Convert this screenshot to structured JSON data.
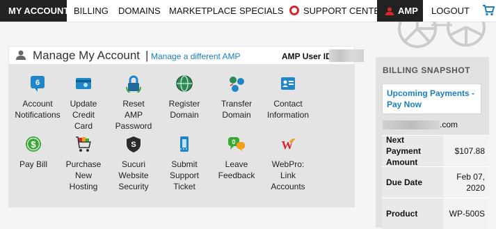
{
  "nav": {
    "my_account": "MY ACCOUNT",
    "billing": "BILLING",
    "domains": "DOMAINS",
    "marketplace": "MARKETPLACE",
    "specials": "SPECIALS",
    "support_center": "SUPPORT CENTER",
    "amp": "AMP",
    "logout": "LOGOUT"
  },
  "manage": {
    "title": "Manage My Account",
    "separator": "|",
    "link": "Manage a different AMP",
    "amp_user_id_label": "AMP User ID:",
    "tiles": [
      {
        "label1": "Account",
        "label2": "Notifications",
        "label3": "",
        "icon": "bell-badge-icon",
        "badge": "6"
      },
      {
        "label1": "Update",
        "label2": "Credit",
        "label3": "Card",
        "icon": "credit-card-icon"
      },
      {
        "label1": "Reset",
        "label2": "AMP",
        "label3": "Password",
        "icon": "lock-icon"
      },
      {
        "label1": "Register",
        "label2": "Domain",
        "label3": "",
        "icon": "globe-icon"
      },
      {
        "label1": "Transfer",
        "label2": "Domain",
        "label3": "",
        "icon": "transfer-globes-icon"
      },
      {
        "label1": "Contact",
        "label2": "Information",
        "label3": "",
        "icon": "contact-card-icon"
      },
      {
        "label1": "Pay Bill",
        "label2": "",
        "label3": "",
        "icon": "dollar-icon"
      },
      {
        "label1": "Purchase",
        "label2": "New",
        "label3": "Hosting",
        "icon": "shopping-cart-icon"
      },
      {
        "label1": "Sucuri",
        "label2": "Website",
        "label3": "Security",
        "icon": "sucuri-shield-icon"
      },
      {
        "label1": "Submit",
        "label2": "Support",
        "label3": "Ticket",
        "icon": "ticket-icon"
      },
      {
        "label1": "Leave",
        "label2": "Feedback",
        "label3": "",
        "icon": "feedback-bubbles-icon"
      },
      {
        "label1": "WebPro:",
        "label2": "Link",
        "label3": "Accounts",
        "icon": "webpro-icon"
      }
    ]
  },
  "billing": {
    "title": "BILLING SNAPSHOT",
    "upcoming": "Upcoming Payments - Pay Now",
    "domain_tld": ".com",
    "rows": [
      {
        "key": "Next Payment Amount",
        "value": "$107.88"
      },
      {
        "key": "Due Date",
        "value": "Feb 07, 2020"
      },
      {
        "key": "Product",
        "value": "WP-500S"
      }
    ]
  },
  "colors": {
    "nav_active_bg": "#222222",
    "link_blue": "#1a7fc1",
    "support_red": "#d9262c",
    "panel_gray": "#e4e4e4"
  }
}
